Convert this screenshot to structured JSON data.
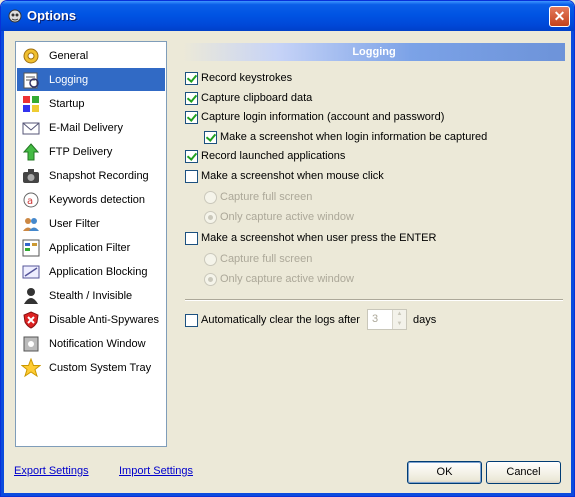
{
  "window": {
    "title": "Options",
    "close_label": "✕"
  },
  "sidebar": {
    "items": [
      {
        "label": "General",
        "icon": "gear-icon",
        "selected": false
      },
      {
        "label": "Logging",
        "icon": "log-icon",
        "selected": true
      },
      {
        "label": "Startup",
        "icon": "startup-icon",
        "selected": false
      },
      {
        "label": "E-Mail Delivery",
        "icon": "email-icon",
        "selected": false
      },
      {
        "label": "FTP Delivery",
        "icon": "ftp-icon",
        "selected": false
      },
      {
        "label": "Snapshot Recording",
        "icon": "camera-icon",
        "selected": false
      },
      {
        "label": "Keywords detection",
        "icon": "keywords-icon",
        "selected": false
      },
      {
        "label": "User Filter",
        "icon": "users-icon",
        "selected": false
      },
      {
        "label": "Application Filter",
        "icon": "app-filter-icon",
        "selected": false
      },
      {
        "label": "Application Blocking",
        "icon": "app-block-icon",
        "selected": false
      },
      {
        "label": "Stealth / Invisible",
        "icon": "stealth-icon",
        "selected": false
      },
      {
        "label": "Disable Anti-Spywares",
        "icon": "shield-icon",
        "selected": false
      },
      {
        "label": "Notification Window",
        "icon": "notification-icon",
        "selected": false
      },
      {
        "label": "Custom System Tray",
        "icon": "star-icon",
        "selected": false
      }
    ]
  },
  "panel": {
    "header": "Logging",
    "options": {
      "record_keystrokes": {
        "label": "Record keystrokes",
        "checked": true
      },
      "capture_clipboard": {
        "label": "Capture clipboard data",
        "checked": true
      },
      "capture_login": {
        "label": "Capture login information (account and password)",
        "checked": true
      },
      "screenshot_login": {
        "label": "Make a screenshot when login information be captured",
        "checked": true
      },
      "record_apps": {
        "label": "Record launched applications",
        "checked": true
      },
      "screenshot_click": {
        "label": "Make a screenshot when mouse click",
        "checked": false
      },
      "click_full": {
        "label": "Capture full screen",
        "selected": false
      },
      "click_active": {
        "label": "Only capture active window",
        "selected": true
      },
      "screenshot_enter": {
        "label": "Make a screenshot when user press the ENTER",
        "checked": false
      },
      "enter_full": {
        "label": "Capture full screen",
        "selected": false
      },
      "enter_active": {
        "label": "Only capture active window",
        "selected": true
      },
      "auto_clear": {
        "label": "Automatically clear the logs after",
        "checked": false,
        "value": "3",
        "unit": "days"
      }
    }
  },
  "footer": {
    "export_label": "Export Settings",
    "import_label": "Import Settings",
    "ok_label": "OK",
    "cancel_label": "Cancel"
  },
  "colors": {
    "selected": "#316ac5",
    "check": "#21a121",
    "titlebar": "#0054e3",
    "link": "#0000cc"
  }
}
